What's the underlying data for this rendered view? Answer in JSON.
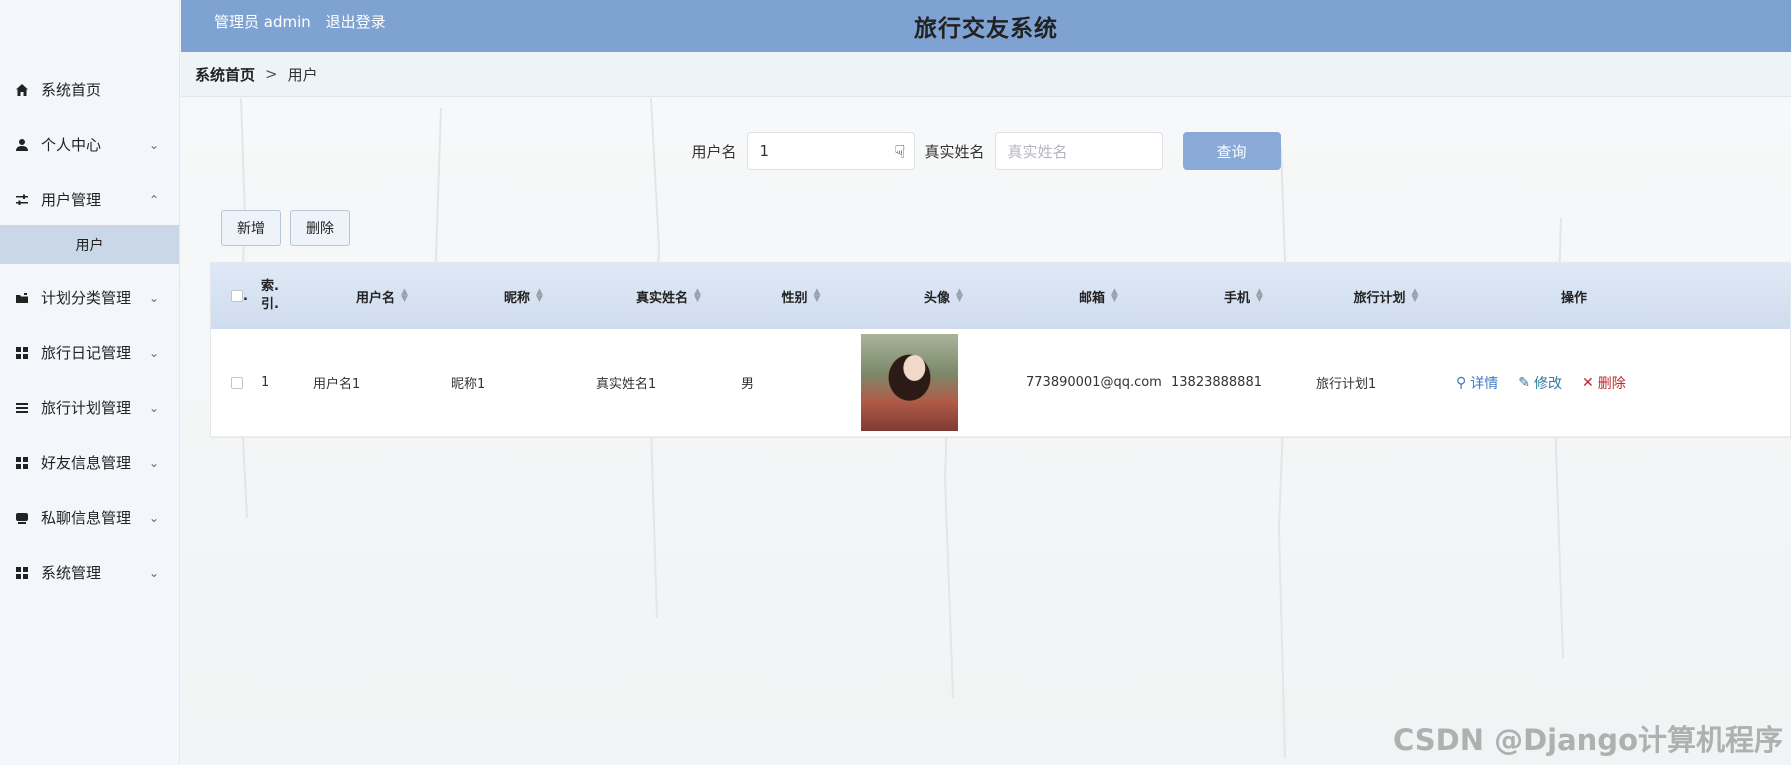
{
  "header": {
    "user_label": "管理员 admin",
    "logout_label": "退出登录",
    "title": "旅行交友系统"
  },
  "breadcrumb": {
    "home": "系统首页",
    "separator": ">",
    "current": "用户"
  },
  "sidebar": {
    "items": [
      {
        "label": "系统首页",
        "icon": "home-icon"
      },
      {
        "label": "个人中心",
        "icon": "user-icon"
      },
      {
        "label": "用户管理",
        "icon": "sliders-icon"
      },
      {
        "label": "用户",
        "icon": ""
      },
      {
        "label": "计划分类管理",
        "icon": "folder-icon"
      },
      {
        "label": "旅行日记管理",
        "icon": "grid-icon"
      },
      {
        "label": "旅行计划管理",
        "icon": "list-icon"
      },
      {
        "label": "好友信息管理",
        "icon": "grid-icon"
      },
      {
        "label": "私聊信息管理",
        "icon": "inbox-icon"
      },
      {
        "label": "系统管理",
        "icon": "grid-icon"
      }
    ]
  },
  "search": {
    "username_label": "用户名",
    "username_value": "1",
    "realname_label": "真实姓名",
    "realname_placeholder": "真实姓名",
    "query_label": "查询"
  },
  "actions": {
    "add_label": "新增",
    "delete_label": "删除"
  },
  "table": {
    "headers": {
      "check": ".",
      "index": "索.\n引.",
      "username": "用户名",
      "nickname": "昵称",
      "realname": "真实姓名",
      "gender": "性别",
      "avatar": "头像",
      "email": "邮箱",
      "phone": "手机",
      "plan": "旅行计划",
      "ops": "操作"
    },
    "rows": [
      {
        "index": "1",
        "username": "用户名1",
        "nickname": "昵称1",
        "realname": "真实姓名1",
        "gender": "男",
        "email": "773890001@qq.com",
        "phone": "13823888881",
        "plan": "旅行计划1",
        "detail": "详情",
        "edit": "修改",
        "delete": "删除"
      }
    ]
  },
  "watermark": "CSDN @Django计算机程序",
  "colors": {
    "header_bg": "#7ea3d2",
    "query_button": "#89aad6",
    "delete_red": "#c0262d"
  }
}
